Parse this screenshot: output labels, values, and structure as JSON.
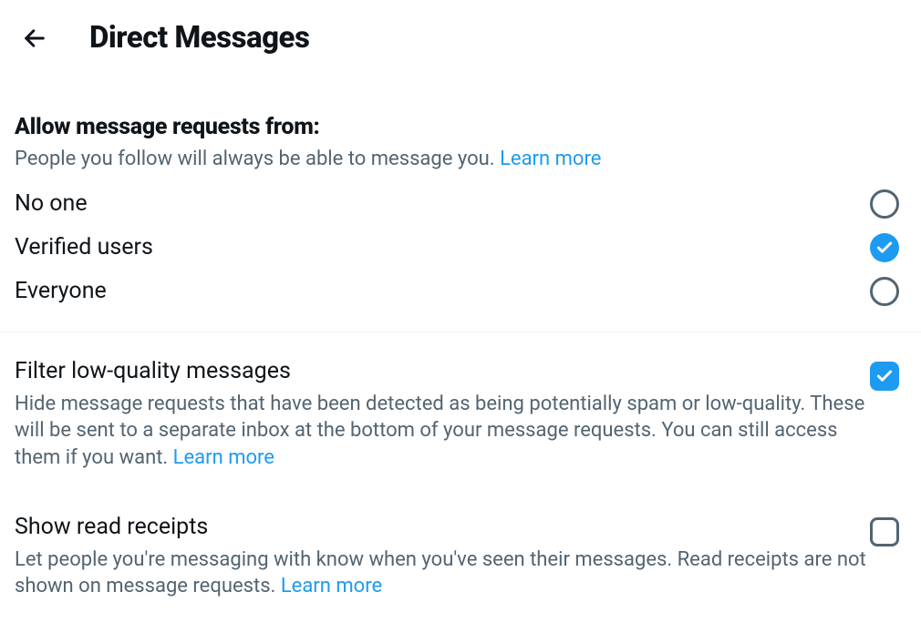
{
  "header": {
    "title": "Direct Messages"
  },
  "allow": {
    "title": "Allow message requests from:",
    "subtitle": "People you follow will always be able to message you. ",
    "learn_more": "Learn more",
    "options": {
      "no_one": "No one",
      "verified": "Verified users",
      "everyone": "Everyone"
    }
  },
  "filter": {
    "title": "Filter low-quality messages",
    "desc": "Hide message requests that have been detected as being potentially spam or low-quality. These will be sent to a separate inbox at the bottom of your message requests. You can still access them if you want. ",
    "learn_more": "Learn more"
  },
  "receipts": {
    "title": "Show read receipts",
    "desc": "Let people you're messaging with know when you've seen their messages. Read receipts are not shown on message requests. ",
    "learn_more": "Learn more"
  }
}
